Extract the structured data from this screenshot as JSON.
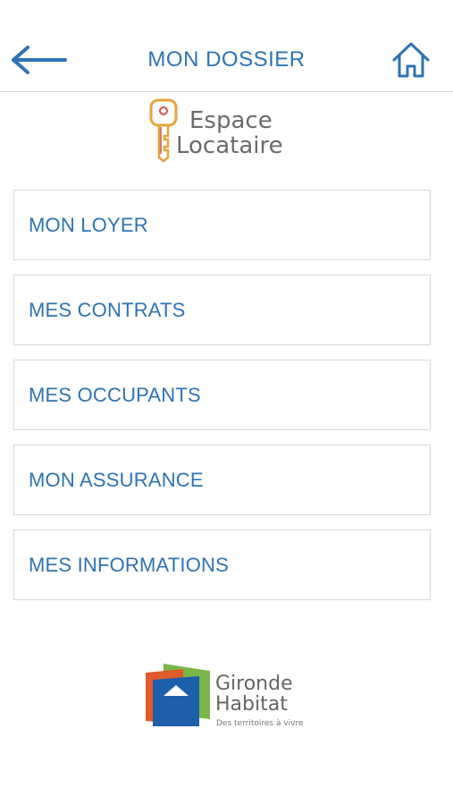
{
  "header": {
    "title": "MON DOSSIER",
    "back_icon": "arrow-left-icon",
    "home_icon": "home-icon",
    "accent_color": "#2e73b5"
  },
  "app_logo": {
    "line1": "Espace",
    "line2": "Locataire",
    "icon": "key-icon"
  },
  "menu": {
    "items": [
      {
        "label": "MON LOYER"
      },
      {
        "label": "MES CONTRATS"
      },
      {
        "label": "MES OCCUPANTS"
      },
      {
        "label": "MON ASSURANCE"
      },
      {
        "label": "MES INFORMATIONS"
      }
    ]
  },
  "footer_logo": {
    "line1": "Gironde",
    "line2": "Habitat",
    "tagline": "Des territoires à vivre"
  }
}
